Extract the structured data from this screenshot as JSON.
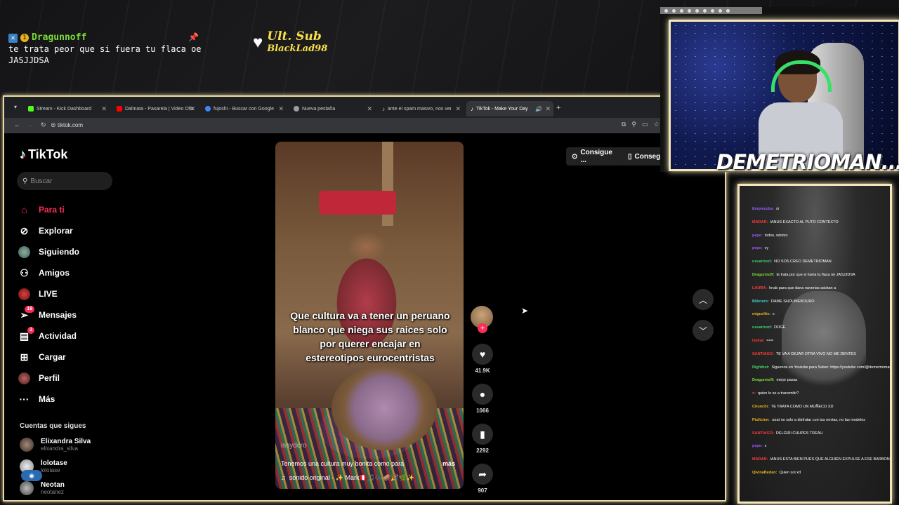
{
  "overlay": {
    "username": "Dragunnoff",
    "message": "te trata peor que si fuera tu flaca oe JASJJDSA",
    "badge2": "1",
    "ult_sub_label": "Ult. Sub",
    "ult_sub_name": "BlackLad98"
  },
  "browser": {
    "tabs": [
      {
        "label": "Stream - Kick Dashboard",
        "color": "#53fc18"
      },
      {
        "label": "Dalmata - Pasarela | Video Ofic",
        "color": "#ff0000"
      },
      {
        "label": "fujoshi - Buscar con Google",
        "color": "#4285f4"
      },
      {
        "label": "Nueva pestaña",
        "color": "#9aa0a6"
      },
      {
        "label": "ante el spam masivo, nos vemo",
        "color": "#ffffff"
      },
      {
        "label": "TikTok - Make Your Day",
        "color": "#ffffff"
      }
    ],
    "url": "tiktok.com"
  },
  "tiktok": {
    "logo": "TikTok",
    "search_placeholder": "Buscar",
    "menu": [
      {
        "label": "Para ti",
        "icon": "home-icon",
        "active": true
      },
      {
        "label": "Explorar",
        "icon": "compass-icon"
      },
      {
        "label": "Siguiendo",
        "icon": "avatar-icon"
      },
      {
        "label": "Amigos",
        "icon": "people-icon"
      },
      {
        "label": "LIVE",
        "icon": "live-icon"
      },
      {
        "label": "Mensajes",
        "icon": "send-icon",
        "badge": "19"
      },
      {
        "label": "Actividad",
        "icon": "inbox-icon",
        "badge": "3"
      },
      {
        "label": "Cargar",
        "icon": "plus-square-icon"
      },
      {
        "label": "Perfil",
        "icon": "profile-icon"
      },
      {
        "label": "Más",
        "icon": "dots-icon"
      }
    ],
    "following_title": "Cuentas que sigues",
    "accounts": [
      {
        "name": "Elixandra Silva",
        "handle": "elixandra_silva"
      },
      {
        "name": "lolotase",
        "handle": "lolotase"
      },
      {
        "name": "Neotan",
        "handle": "neotanez"
      }
    ],
    "pills": [
      "Consigue ...",
      "Consegui"
    ],
    "video": {
      "caption": "Que cultura va a tener un peruano blanco que niega sus raices solo por querer encajar en estereotipos eurocentristas",
      "author": "issydcro",
      "description": "Tenemos una cultura muy bonita como para",
      "more": "más",
      "sound": "sonido original - ✨ Mark🇵🇪🎵🎶🥔🎉🌿✨"
    },
    "stats": {
      "likes": "41.9K",
      "comments": "1066",
      "saves": "2292",
      "shares": "907"
    }
  },
  "webcam": {
    "name": "DEMETRIOMAN..."
  },
  "sidechat": [
    {
      "user": "Empiezuba",
      "msg": "si",
      "color": "#9b59ff"
    },
    {
      "user": "MADAR",
      "msg": "IANUS EXACTO AL PUTO CONTEXTO",
      "color": "#ff3b3b"
    },
    {
      "user": "pepe",
      "msg": "todos, wtomo",
      "color": "#9b59ff"
    },
    {
      "user": "pepe",
      "msg": "vy",
      "color": "#9b59ff"
    },
    {
      "user": "usuarioxd",
      "msg": "NO SOS CREO DEMETRIOMAN",
      "color": "#3ad16e"
    },
    {
      "user": "Dragunnoff",
      "msg": "te trata por que si fuera tu flaca oe JASJJDSA",
      "color": "#7bdc3a"
    },
    {
      "user": "LAURA",
      "msg": "hnab para que dana naverias asistan a",
      "color": "#ff3b3b"
    },
    {
      "user": "Billetero",
      "msg": "DAME SHOUMEBOURO",
      "color": "#3ad1c7"
    },
    {
      "user": "miguelitx",
      "msg": "x",
      "color": "#e9b21d"
    },
    {
      "user": "usuarioxd",
      "msg": "DOGE",
      "color": "#3ad16e"
    },
    {
      "user": "Uoitoi",
      "msg": "===",
      "color": "#ff3b3b"
    },
    {
      "user": "SANTIAGO",
      "msg": "TE VA A DEJAR OTRA VIVO NO ME DENTES",
      "color": "#ff3b3b"
    },
    {
      "user": "Nightbot",
      "msg": "Siguenos en Youtube para Saber: https://youtube.com/@demetrioman",
      "color": "#3ad16e"
    },
    {
      "user": "Dragunnoff",
      "msg": "mejor pasas",
      "color": "#7bdc3a"
    },
    {
      "user": "x",
      "msg": "quien lo se a transmitir?",
      "color": "#ff3b3b"
    },
    {
      "user": "Chunchi",
      "msg": "TE TRATA COMO UN MUÑECO XD",
      "color": "#e9b21d"
    },
    {
      "user": "Piuficien",
      "msg": "rurat no solo a disfrutar con tus novias, no las modelos",
      "color": "#e9b21d"
    },
    {
      "user": "SANTIAGO",
      "msg": "DELGIRI CHUPES TREAU",
      "color": "#ff3b3b"
    },
    {
      "user": "pepe",
      "msg": "x",
      "color": "#9b59ff"
    },
    {
      "user": "MADAR",
      "msg": "IANUS ESTA BIEN PUES QUE ALGUIEN EXPULSE A ESE BARBON",
      "color": "#ff3b3b"
    },
    {
      "user": "QlvinaBedan",
      "msg": "Quien soi xd",
      "color": "#e9b21d"
    }
  ]
}
